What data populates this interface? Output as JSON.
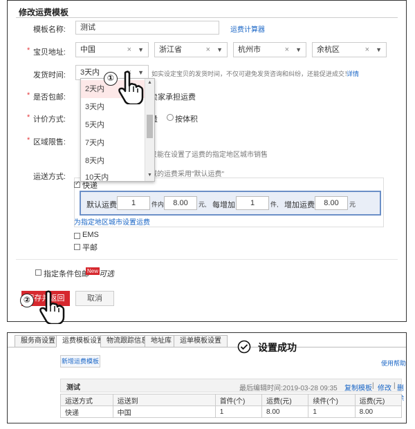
{
  "form": {
    "title": "修改运费模板",
    "template_name_label": "模板名称:",
    "template_name_value": "测试",
    "calculator_link": "运费计算器",
    "location_label": "宝贝地址:",
    "location": [
      "中国",
      "浙江省",
      "杭州市",
      "余杭区"
    ],
    "ship_time_label": "发货时间:",
    "ship_time_value": "3天内",
    "ship_time_note": "如实设定宝贝的发货时间，不仅可避免发货咨询和纠纷，还能促进成交！",
    "ship_time_detail_link": "详情",
    "free_ship_label": "是否包邮:",
    "free_ship_text": "卖家承担运费",
    "pricing_label": "计价方式:",
    "pricing_partial": "量",
    "pricing_volume": "按体积",
    "region_label": "区域限售:",
    "region_note": "只能在设置了运费的指定地区城市销售",
    "shipping_method_label": "运送方式:",
    "default_fee_note": "域的运费采用\"默认运费\"",
    "express_label": "快递",
    "default_fee_label": "默认运费",
    "default_qty": "1",
    "unit_within": "件内",
    "default_fee": "8.00",
    "yuan": "元,",
    "each_add_label": "每增加",
    "add_qty": "1",
    "unit_comma": "件,",
    "add_fee_label": "增加运费",
    "add_fee": "8.00",
    "yuan_end": "元",
    "specify_region_link": "为指定地区城市设置运费",
    "ems_label": "EMS",
    "post_label": "平邮",
    "conditional_free_label": "指定条件包邮",
    "new_badge": "New",
    "optional_label": "可选",
    "save_button": "保存并返回",
    "cancel_button": "取消"
  },
  "dropdown": {
    "options": [
      "2天内",
      "3天内",
      "5天内",
      "7天内",
      "8天内",
      "10天内"
    ]
  },
  "steps": {
    "step1": "①",
    "step2": "②"
  },
  "result": {
    "tabs": [
      "服务商设置",
      "运费模板设置",
      "物流跟踪信息",
      "地址库",
      "运单模板设置"
    ],
    "success_icon": "check-circle-icon",
    "success_text": "设置成功",
    "add_template_button": "新增运费模板",
    "help_link": "使用帮助",
    "template_name": "测试",
    "last_edit_label": "最后编辑时间:2019-03-28 09:35",
    "copy_link": "复制模板",
    "edit_link": "修改",
    "delete_link": "删除",
    "table_headers": [
      "运送方式",
      "运送到",
      "首件(个)",
      "运费(元)",
      "续件(个)",
      "运费(元)"
    ],
    "table_rows": [
      [
        "快递",
        "中国",
        "1",
        "8.00",
        "1",
        "8.00"
      ]
    ]
  },
  "colors": {
    "accent": "#d6282e",
    "link": "#1a66c6",
    "highlight": "#6b8fc7"
  }
}
